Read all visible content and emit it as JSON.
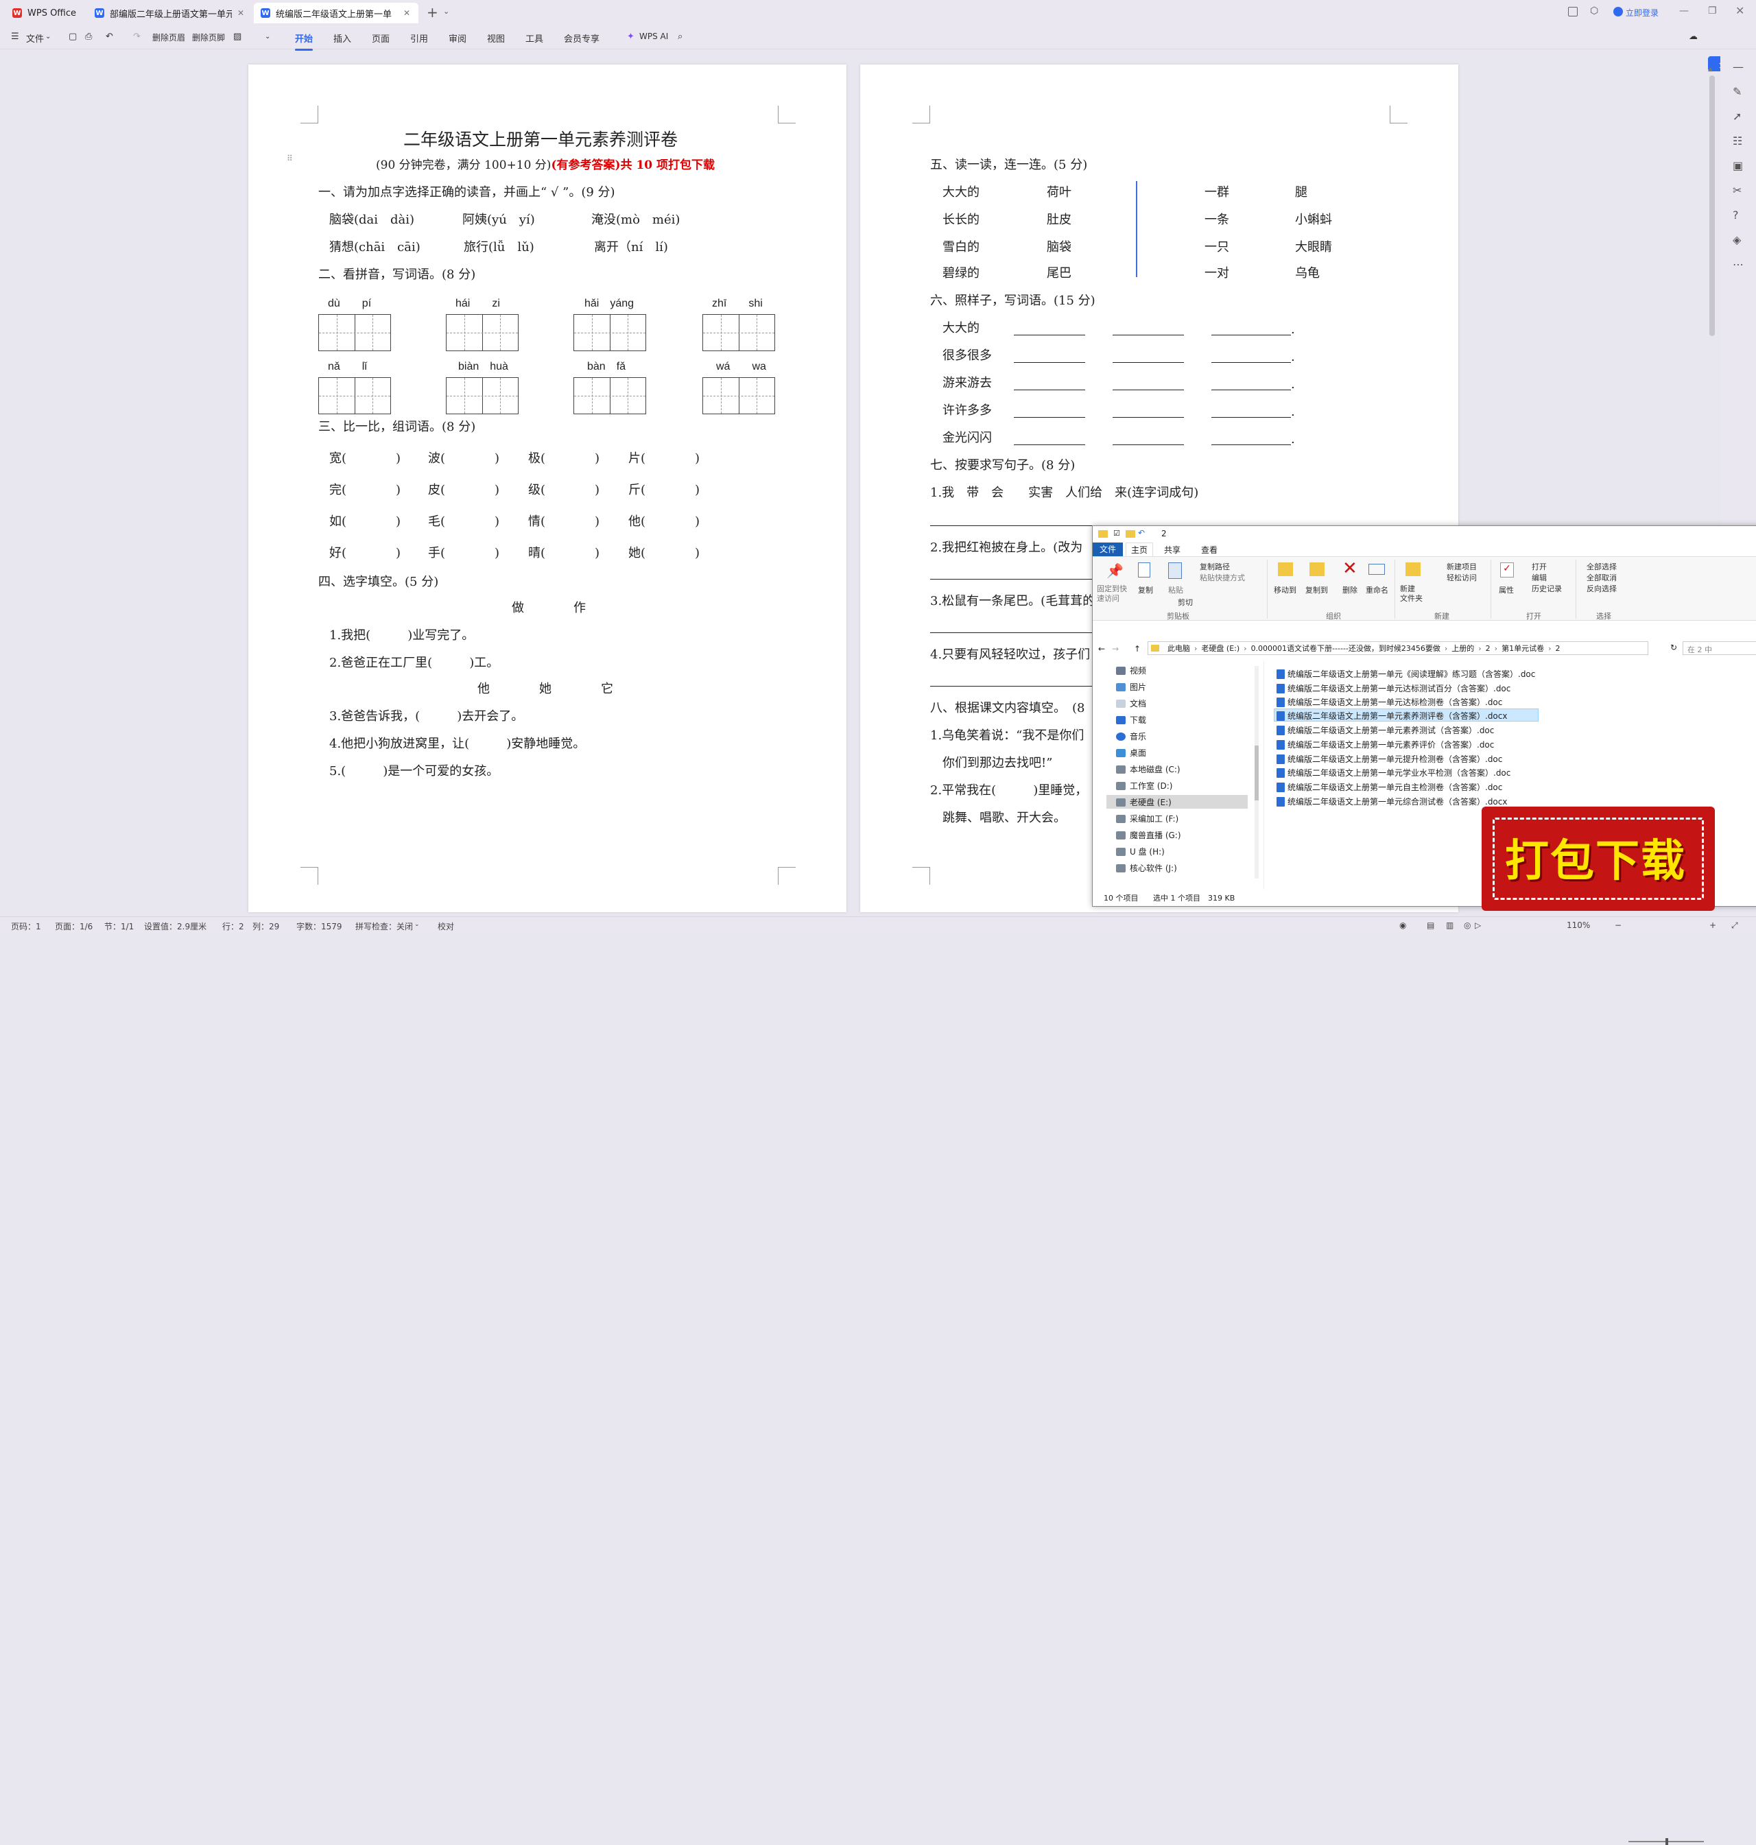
{
  "app": {
    "tabs": [
      {
        "label": "WPS Office"
      },
      {
        "label": "部编版二年级上册语文第一单元测"
      },
      {
        "label": "统编版二年级语文上册第一单"
      }
    ],
    "add_tab": "+",
    "login": "立即登录",
    "share": "分享"
  },
  "toolbar": {
    "file": "文件",
    "del_header": "删除页眉",
    "del_footer": "删除页脚",
    "tabs": [
      "开始",
      "插入",
      "页面",
      "引用",
      "审阅",
      "视图",
      "工具",
      "会员专享"
    ],
    "wps_ai": "WPS AI"
  },
  "page1": {
    "title": "二年级语文上册第一单元素养测评卷",
    "subtitle_a": "(90 分钟完卷，满分 100+10 分)",
    "subtitle_b": "(有参考答案)共 10 项打包下载",
    "q1": "一、请为加点字选择正确的读音，并画上“ √ ”。(9 分)",
    "q1_items": [
      "脑袋(dai　dài)",
      "阿姨(yú　yí)",
      "淹没(mò　méi)",
      "猜想(chāi　cāi)",
      "旅行(lǚ　lǔ)",
      "离开（ní　lí)"
    ],
    "q2": "二、看拼音，写词语。(8 分)",
    "pinyin_row1": [
      "dù　　pí",
      "hái　　zi",
      "hǎi　yáng",
      "zhī　　shi"
    ],
    "pinyin_row2": [
      "nǎ　　lǐ",
      "biàn　huà",
      "bàn　fǎ",
      "wá　　wa"
    ],
    "q3": "三、比一比，组词语。(8 分)",
    "q3_rows": [
      [
        "宽(　　　　)",
        "波(　　　　)",
        "极(　　　　)",
        "片(　　　　)"
      ],
      [
        "完(　　　　)",
        "皮(　　　　)",
        "级(　　　　)",
        "斤(　　　　)"
      ],
      [
        "如(　　　　)",
        "毛(　　　　)",
        "情(　　　　)",
        "他(　　　　)"
      ],
      [
        "好(　　　　)",
        "手(　　　　)",
        "晴(　　　　)",
        "她(　　　　)"
      ]
    ],
    "q4": "四、选字填空。(5 分)",
    "q4_choices1": "做　　　　作",
    "q4_s1": "1.我把(　　　)业写完了。",
    "q4_s2": "2.爸爸正在工厂里(　　　)工。",
    "q4_choices2": "他　　　　她　　　　它",
    "q4_s3": "3.爸爸告诉我，(　　　)去开会了。",
    "q4_s4": "4.他把小狗放进窝里，让(　　　)安静地睡觉。",
    "q4_s5": "5.(　　　)是一个可爱的女孩。"
  },
  "page2": {
    "q5": "五、读一读，连一连。(5 分)",
    "q5_left": [
      "大大的",
      "长长的",
      "雪白的",
      "碧绿的"
    ],
    "q5_mid": [
      "荷叶",
      "肚皮",
      "脑袋",
      "尾巴"
    ],
    "q5_right1": [
      "一群",
      "一条",
      "一只",
      "一对"
    ],
    "q5_right2": [
      "腿",
      "小蝌蚪",
      "大眼睛",
      "乌龟"
    ],
    "q6": "六、照样子，写词语。(15 分)",
    "q6_items": [
      "大大的",
      "很多很多",
      "游来游去",
      "许许多多",
      "金光闪闪"
    ],
    "q6_dot": ".",
    "q7": "七、按要求写句子。(8 分)",
    "q7_s1": "1.我　带　会　　实害　人们给　来(连字词成句)",
    "q7_s2": "2.我把红袍披在身上。(改为",
    "q7_s3": "3.松鼠有一条尾巴。(毛茸茸的",
    "q7_s4": "4.只要有风轻轻吹过，孩子们",
    "q8": "八、根据课文内容填空。　(8",
    "q8_s1": "1.乌龟笑着说：“我不是你们",
    "q8_s1b": "你们到那边去找吧!”",
    "q8_s2": "2.平常我在(　　　)里睡觉，",
    "q8_s2b": "跳舞、唱歌、开大会。"
  },
  "explorer": {
    "title": "2",
    "ribbon_tabs": [
      "文件",
      "主页",
      "共享",
      "查看"
    ],
    "ribbon": {
      "pin": "固定到快\n速访问",
      "copy": "复制",
      "paste": "粘贴",
      "copy_path": "复制路径",
      "paste_shortcut": "粘贴快捷方式",
      "cut": "剪切",
      "group_clipboard": "剪贴板",
      "move_to": "移动到",
      "copy_to": "复制到",
      "delete": "删除",
      "rename": "重命名",
      "group_organize": "组织",
      "new_folder": "新建\n文件夹",
      "new_item": "新建项目",
      "easy_access": "轻松访问",
      "group_new": "新建",
      "properties": "属性",
      "open": "打开",
      "edit": "编辑",
      "history": "历史记录",
      "group_open": "打开",
      "select_all": "全部选择",
      "select_none": "全部取消",
      "invert": "反向选择",
      "group_select": "选择"
    },
    "breadcrumb": [
      "此电脑",
      "老硬盘 (E:)",
      "0.000001语文试卷下册------还没做，到时候23456要做",
      "上册的",
      "2",
      "第1单元试卷",
      "2"
    ],
    "search_placeholder": "在 2 中",
    "nav_items": [
      "视频",
      "图片",
      "文档",
      "下载",
      "音乐",
      "桌面",
      "本地磁盘 (C:)",
      "工作室 (D:)",
      "老硬盘 (E:)",
      "采编加工 (F:)",
      "魔兽直播 (G:)",
      "U 盘 (H:)",
      "核心软件 (J:)"
    ],
    "files": [
      "统编版二年级语文上册第一单元《阅读理解》练习题（含答案）.doc",
      "统编版二年级语文上册第一单元达标测试百分（含答案）.doc",
      "统编版二年级语文上册第一单元达标检测卷（含答案）.doc",
      "统编版二年级语文上册第一单元素养测评卷（含答案）.docx",
      "统编版二年级语文上册第一单元素养测试（含答案）.doc",
      "统编版二年级语文上册第一单元素养评价（含答案）.doc",
      "统编版二年级语文上册第一单元提升检测卷（含答案）.doc",
      "统编版二年级语文上册第一单元学业水平检测（含答案）.doc",
      "统编版二年级语文上册第一单元自主检测卷（含答案）.doc",
      "统编版二年级语文上册第一单元综合测试卷（含答案）.docx"
    ],
    "selected_index": 3,
    "status_count": "10 个项目",
    "status_selected": "选中 1 个项目　319 KB"
  },
  "promo": {
    "text": "打包下载"
  },
  "status": {
    "page": "页码：1",
    "pages": "页面：1/6",
    "section": "节：1/1",
    "setting": "设置值：2.9厘米",
    "row": "行：2",
    "col": "列：29",
    "words": "字数：1579",
    "spell": "拼写检查：关闭",
    "proof": "校对",
    "zoom": "110%"
  },
  "colors": {
    "accent": "#2f6af0",
    "red": "#e00000",
    "promo": "#c41414"
  }
}
